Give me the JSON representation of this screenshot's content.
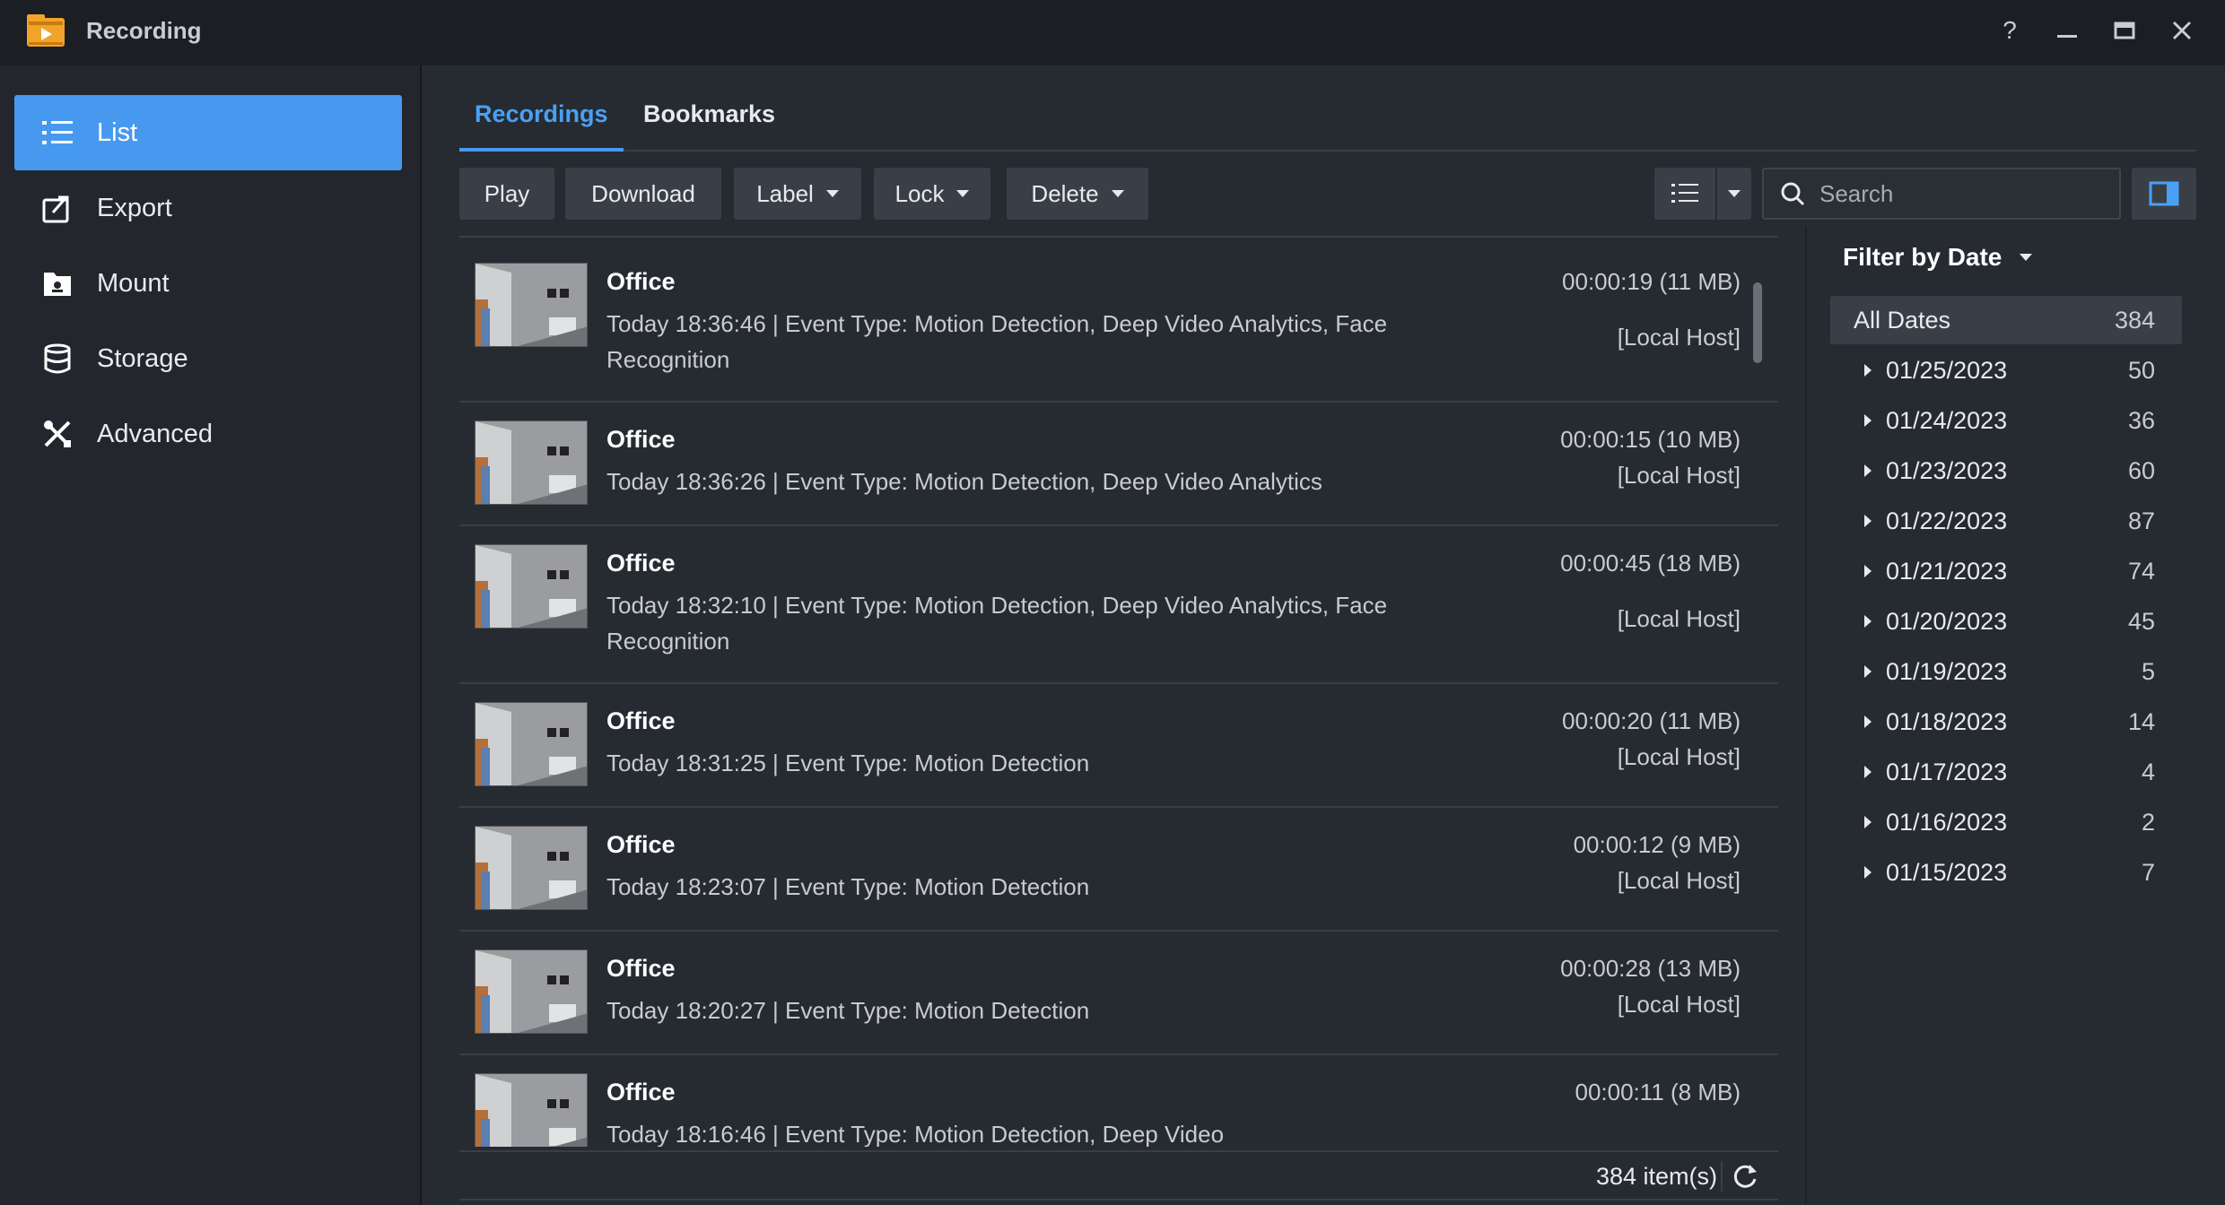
{
  "app": {
    "title": "Recording"
  },
  "window_controls": {
    "help": "?",
    "minimize": "—",
    "maximize": "▭",
    "close": "✕"
  },
  "sidebar": {
    "items": [
      {
        "label": "List",
        "icon": "list-icon",
        "active": true
      },
      {
        "label": "Export",
        "icon": "export-icon",
        "active": false
      },
      {
        "label": "Mount",
        "icon": "mount-icon",
        "active": false
      },
      {
        "label": "Storage",
        "icon": "storage-icon",
        "active": false
      },
      {
        "label": "Advanced",
        "icon": "tools-icon",
        "active": false
      }
    ]
  },
  "tabs": [
    {
      "label": "Recordings",
      "active": true
    },
    {
      "label": "Bookmarks",
      "active": false
    }
  ],
  "toolbar": {
    "play": "Play",
    "download": "Download",
    "label": "Label",
    "lock": "Lock",
    "delete": "Delete"
  },
  "search": {
    "placeholder": "Search",
    "value": ""
  },
  "recordings": [
    {
      "title": "Office",
      "desc": "Today 18:36:46 | Event Type: Motion Detection, Deep Video Analytics, Face Recognition",
      "duration": "00:00:19 (11 MB)",
      "host": "[Local Host]"
    },
    {
      "title": "Office",
      "desc": "Today 18:36:26 | Event Type: Motion Detection, Deep Video Analytics",
      "duration": "00:00:15 (10 MB)",
      "host": "[Local Host]"
    },
    {
      "title": "Office",
      "desc": "Today 18:32:10 | Event Type: Motion Detection, Deep Video Analytics, Face Recognition",
      "duration": "00:00:45 (18 MB)",
      "host": "[Local Host]"
    },
    {
      "title": "Office",
      "desc": "Today 18:31:25 | Event Type: Motion Detection",
      "duration": "00:00:20 (11 MB)",
      "host": "[Local Host]"
    },
    {
      "title": "Office",
      "desc": "Today 18:23:07 | Event Type: Motion Detection",
      "duration": "00:00:12 (9 MB)",
      "host": "[Local Host]"
    },
    {
      "title": "Office",
      "desc": "Today 18:20:27 | Event Type: Motion Detection",
      "duration": "00:00:28 (13 MB)",
      "host": "[Local Host]"
    },
    {
      "title": "Office",
      "desc": "Today 18:16:46 | Event Type: Motion Detection, Deep Video",
      "duration": "00:00:11 (8 MB)",
      "host": ""
    }
  ],
  "status": {
    "item_count": "384 item(s)"
  },
  "filter": {
    "title": "Filter by Date",
    "all": {
      "label": "All Dates",
      "count": "384"
    },
    "dates": [
      {
        "date": "01/25/2023",
        "count": "50"
      },
      {
        "date": "01/24/2023",
        "count": "36"
      },
      {
        "date": "01/23/2023",
        "count": "60"
      },
      {
        "date": "01/22/2023",
        "count": "87"
      },
      {
        "date": "01/21/2023",
        "count": "74"
      },
      {
        "date": "01/20/2023",
        "count": "45"
      },
      {
        "date": "01/19/2023",
        "count": "5"
      },
      {
        "date": "01/18/2023",
        "count": "14"
      },
      {
        "date": "01/17/2023",
        "count": "4"
      },
      {
        "date": "01/16/2023",
        "count": "2"
      },
      {
        "date": "01/15/2023",
        "count": "7"
      }
    ]
  },
  "colors": {
    "accent": "#4799ef",
    "background": "#262a31",
    "titlebar": "#1b1e23",
    "sidebar": "#23272d"
  }
}
